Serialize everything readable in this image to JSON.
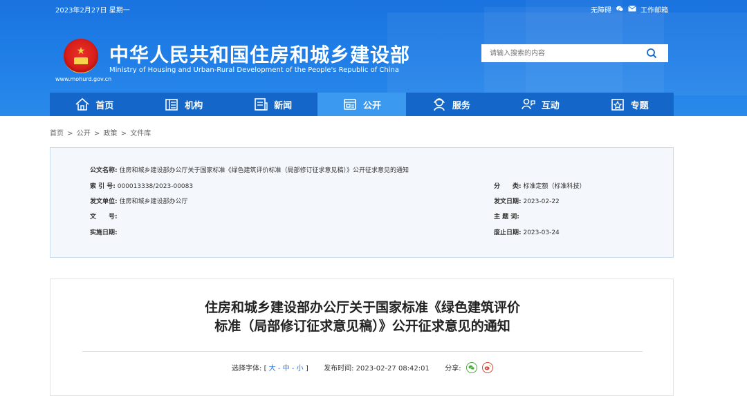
{
  "topbar": {
    "date": "2023年2月27日 星期一",
    "accessibility": "无障碍",
    "mail": "工作邮箱"
  },
  "site": {
    "title": "中华人民共和国住房和城乡建设部",
    "subtitle": "Ministry of Housing and Urban-Rural Development of the People's Republic of China",
    "url": "www.mohurd.gov.cn"
  },
  "search": {
    "placeholder": "请输入搜索的内容"
  },
  "nav": {
    "items": [
      {
        "label": "首页",
        "icon": "home-icon"
      },
      {
        "label": "机构",
        "icon": "organization-icon"
      },
      {
        "label": "新闻",
        "icon": "news-icon"
      },
      {
        "label": "公开",
        "icon": "open-icon",
        "active": true
      },
      {
        "label": "服务",
        "icon": "service-icon"
      },
      {
        "label": "互动",
        "icon": "interaction-icon"
      },
      {
        "label": "专题",
        "icon": "topic-icon"
      }
    ]
  },
  "breadcrumb": [
    "首页",
    ">",
    "公开",
    ">",
    "政策",
    ">",
    "文件库"
  ],
  "meta": {
    "title_label": "公文名称:",
    "title_value": "住房和城乡建设部办公厅关于国家标准《绿色建筑评价标准（局部修订征求意见稿）》公开征求意见的通知",
    "index_label": "索 引 号:",
    "index_value": "000013338/2023-00083",
    "issuer_label": "发文单位:",
    "issuer_value": "住房和城乡建设部办公厅",
    "docno_label": "文　　号:",
    "docno_value": "",
    "impl_label": "实施日期:",
    "impl_value": "",
    "category_label": "分　　类:",
    "category_value": "标准定额（标准科技）",
    "date_label": "发文日期:",
    "date_value": "2023-02-22",
    "keywords_label": "主 题 词:",
    "keywords_value": "",
    "deadline_label": "废止日期:",
    "deadline_value": "2023-03-24"
  },
  "article": {
    "title_line1": "住房和城乡建设部办公厅关于国家标准《绿色建筑评价",
    "title_line2": "标准（局部修订征求意见稿）》公开征求意见的通知",
    "font_label": "选择字体:",
    "font_open": "[",
    "font_large": "大",
    "font_sep1": "-",
    "font_medium": "中",
    "font_sep2": "-",
    "font_small": "小",
    "font_close": "]",
    "publish_label": "发布时间:",
    "publish_time": "2023-02-27 08:42:01",
    "share_label": "分享:"
  },
  "colors": {
    "header_blue": "#1f7de6",
    "nav_blue": "#1467c8",
    "nav_active": "#3b9af0",
    "meta_bg": "#f4f8fc"
  }
}
